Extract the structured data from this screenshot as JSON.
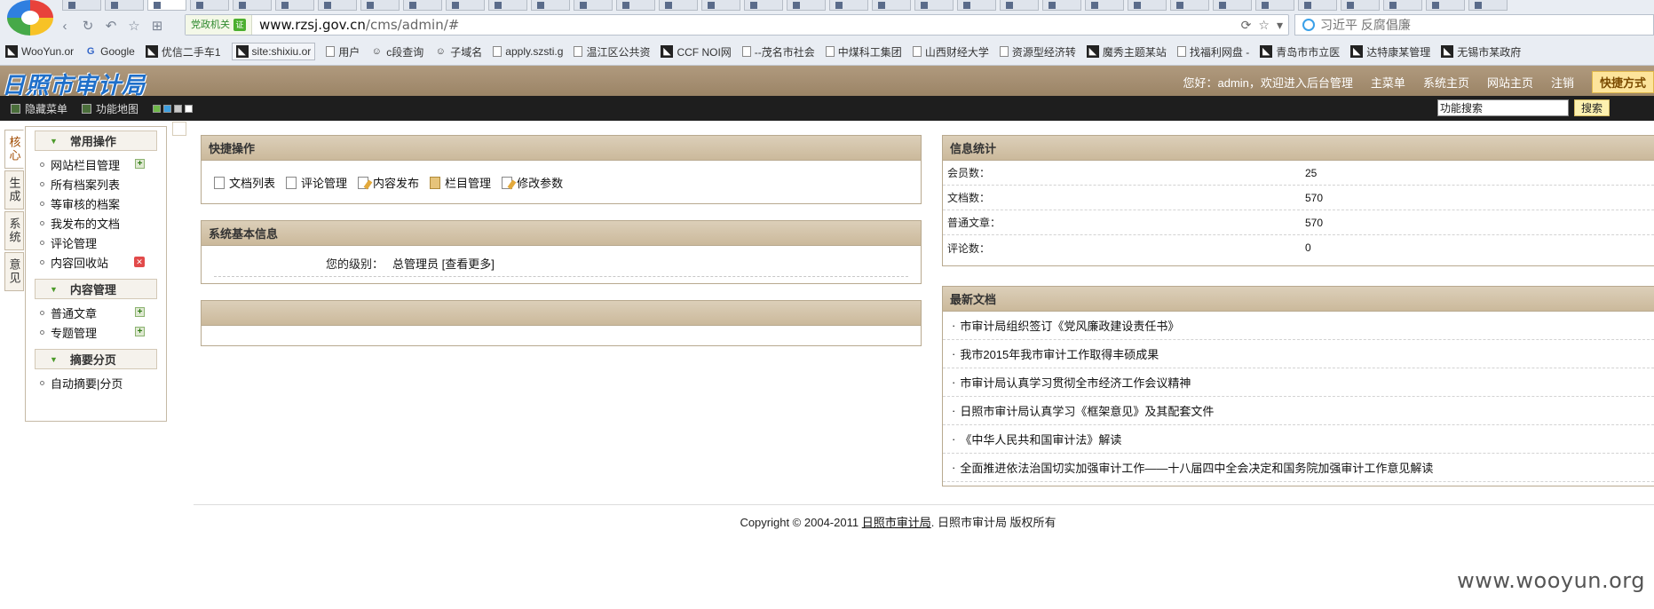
{
  "browser": {
    "site_badge": "党政机关",
    "url_host": "www.rzsj.gov.cn",
    "url_path": "/cms/admin/#",
    "search_placeholder": "习近平 反腐倡廉",
    "bookmarks": [
      {
        "label": "WooYun.or",
        "icon": "dark"
      },
      {
        "label": "Google",
        "icon": "google"
      },
      {
        "label": "优信二手车1",
        "icon": "dark"
      },
      {
        "label": "site:shixiu.or",
        "icon": "dark",
        "highlight": true
      },
      {
        "label": "用户",
        "icon": "page"
      },
      {
        "label": "c段查询",
        "icon": "mask"
      },
      {
        "label": "子域名",
        "icon": "mask"
      },
      {
        "label": "apply.szsti.g",
        "icon": "page"
      },
      {
        "label": "温江区公共资",
        "icon": "page"
      },
      {
        "label": "CCF NOI网",
        "icon": "dark"
      },
      {
        "label": "--茂名市社会",
        "icon": "page"
      },
      {
        "label": "中煤科工集团",
        "icon": "page"
      },
      {
        "label": "山西财经大学",
        "icon": "page"
      },
      {
        "label": "资源型经济转",
        "icon": "page"
      },
      {
        "label": "魔秀主题某站",
        "icon": "dark"
      },
      {
        "label": "找福利网盘 -",
        "icon": "page"
      },
      {
        "label": "青岛市市立医",
        "icon": "dark"
      },
      {
        "label": "达特康某管理",
        "icon": "dark"
      },
      {
        "label": "无锡市某政府",
        "icon": "dark"
      }
    ]
  },
  "header": {
    "logo": "日照市审计局",
    "greeting": "您好：admin，欢迎进入后台管理",
    "nav": [
      "主菜单",
      "系统主页",
      "网站主页",
      "注销"
    ],
    "quick_button": "快捷方式"
  },
  "toolbar": {
    "hide_menu": "隐藏菜单",
    "func_map": "功能地图",
    "swatch_colors": [
      "#6fb84a",
      "#3f9fe0",
      "#c9c9c9",
      "#ffffff"
    ],
    "search_value": "功能搜索",
    "search_button": "搜索"
  },
  "vtabs": [
    "核心",
    "生成",
    "系统",
    "意见"
  ],
  "left_menu": [
    {
      "title": "常用操作",
      "items": [
        {
          "label": "网站栏目管理",
          "action": "add"
        },
        {
          "label": "所有档案列表",
          "action": ""
        },
        {
          "label": "等审核的档案",
          "action": ""
        },
        {
          "label": "我发布的文档",
          "action": ""
        },
        {
          "label": "评论管理",
          "action": ""
        },
        {
          "label": "内容回收站",
          "action": "delete"
        }
      ]
    },
    {
      "title": "内容管理",
      "items": [
        {
          "label": "普通文章",
          "action": "add"
        },
        {
          "label": "专题管理",
          "action": "add"
        }
      ]
    },
    {
      "title": "摘要分页",
      "items": [
        {
          "label": "自动摘要|分页",
          "action": ""
        }
      ]
    }
  ],
  "quick_ops": {
    "title": "快捷操作",
    "links": [
      {
        "label": "文档列表",
        "icon": "page"
      },
      {
        "label": "评论管理",
        "icon": "comment"
      },
      {
        "label": "内容发布",
        "icon": "edit"
      },
      {
        "label": "栏目管理",
        "icon": "folder"
      },
      {
        "label": "修改参数",
        "icon": "edit"
      }
    ]
  },
  "sys_info": {
    "title": "系统基本信息",
    "level_label": "您的级别：",
    "level_value": "总管理员 [查看更多]"
  },
  "stats": {
    "title": "信息统计",
    "rows": [
      {
        "label": "会员数：",
        "value": "25"
      },
      {
        "label": "文档数：",
        "value": "570"
      },
      {
        "label": "普通文章：",
        "value": "570"
      },
      {
        "label": "评论数：",
        "value": "0"
      }
    ]
  },
  "latest_docs": {
    "title": "最新文档",
    "items": [
      "市审计局组织签订《党风廉政建设责任书》",
      "我市2015年我市审计工作取得丰硕成果",
      "市审计局认真学习贯彻全市经济工作会议精神",
      "日照市审计局认真学习《框架意见》及其配套文件",
      "《中华人民共和国审计法》解读",
      "全面推进依法治国切实加强审计工作——十八届四中全会决定和国务院加强审计工作意见解读"
    ]
  },
  "footer": {
    "prefix": "Copyright © 2004-2011 ",
    "link": "日照市审计局",
    "suffix": ". 日照市审计局  版权所有"
  },
  "watermark": "www.wooyun.org"
}
